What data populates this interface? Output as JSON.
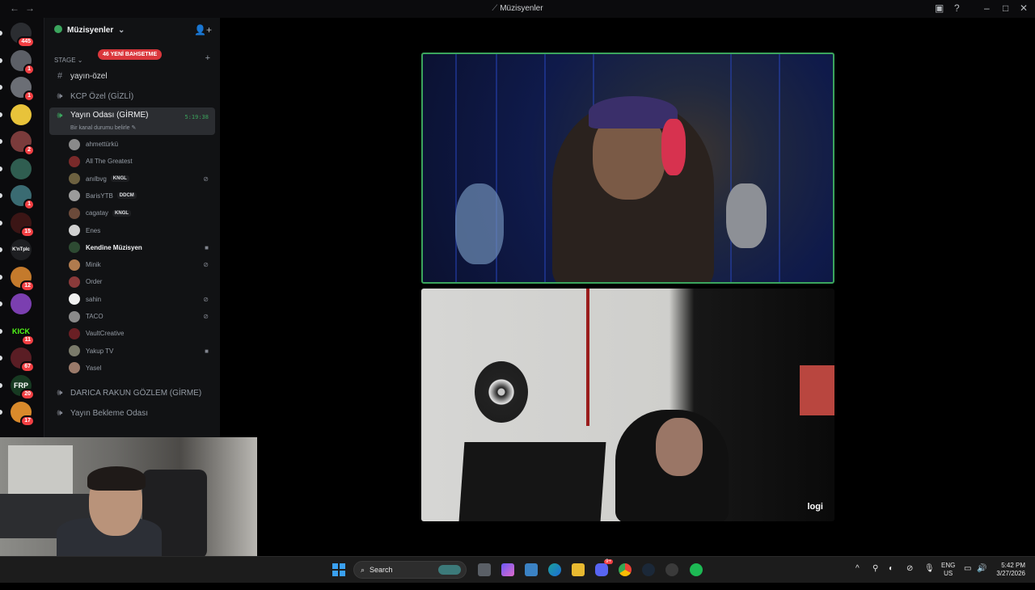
{
  "window": {
    "title": "Müzisyenler"
  },
  "server": {
    "name": "Müzisyenler"
  },
  "rail": {
    "servers": [
      {
        "abbr": "",
        "badge": "445",
        "color": "#2b2d31",
        "icon": "discord-home-icon"
      },
      {
        "abbr": "",
        "badge": "1",
        "color": "#5c5f66",
        "icon": "user-dm-avatar"
      },
      {
        "abbr": "",
        "badge": "1",
        "color": "#6b6e75",
        "icon": "user-dm-avatar"
      },
      {
        "abbr": "",
        "badge": "",
        "color": "#e8c33a",
        "icon": "server-icon"
      },
      {
        "abbr": "",
        "badge": "2",
        "color": "#7a3b3b",
        "icon": "server-icon"
      },
      {
        "abbr": "",
        "badge": "",
        "color": "#2f5d50",
        "icon": "server-icon"
      },
      {
        "abbr": "",
        "badge": "1",
        "color": "#3a6b72",
        "icon": "server-icon"
      },
      {
        "abbr": "",
        "badge": "15",
        "color": "#3b1515",
        "icon": "server-icon"
      },
      {
        "abbr": "K'nTplc",
        "badge": "",
        "color": "#1e1f22",
        "icon": "server-icon"
      },
      {
        "abbr": "",
        "badge": "12",
        "color": "#c47a2c",
        "icon": "server-icon"
      },
      {
        "abbr": "",
        "badge": "",
        "color": "#7b3fb0",
        "icon": "server-icon"
      },
      {
        "abbr": "KICK",
        "badge": "11",
        "color": "#0b0b0d",
        "icon": "kick-icon"
      },
      {
        "abbr": "",
        "badge": "67",
        "color": "#5a1d24",
        "icon": "server-icon"
      },
      {
        "abbr": "FRP",
        "badge": "20",
        "color": "#173a22",
        "icon": "server-icon"
      },
      {
        "abbr": "",
        "badge": "17",
        "color": "#d98a2b",
        "icon": "server-icon"
      }
    ]
  },
  "sidebar": {
    "category": "STAGE",
    "mention_pill": "46 YENİ BAHSETME",
    "channels": {
      "text1": "yayın-özel",
      "voice1": "KCP Özel (GİZLİ)",
      "voice2": "Yayın Odası (GİRME)",
      "voice2_timer": "5:19:38",
      "voice2_status": "Bir kanal durumu belirle",
      "voice3": "DARICA RAKUN GÖZLEM (GİRME)",
      "voice4": "Yayın Bekleme Odası"
    },
    "voice_users": [
      {
        "name": "ahmettürkü",
        "tag": "",
        "status_icon": "",
        "color": "#8a8a8a"
      },
      {
        "name": "All The Greatest",
        "tag": "",
        "status_icon": "",
        "color": "#7a2a2a"
      },
      {
        "name": "anılbvg",
        "tag": "KNGL",
        "status_icon": "muted-icon",
        "color": "#6d6140"
      },
      {
        "name": "BarisYTB",
        "tag": "DDCM",
        "status_icon": "",
        "color": "#9b9b9b"
      },
      {
        "name": "cagatay",
        "tag": "KNGL",
        "status_icon": "",
        "color": "#6b4a3a"
      },
      {
        "name": "Enes",
        "tag": "",
        "status_icon": "",
        "color": "#d0d0d0"
      },
      {
        "name": "Kendine Müzisyen",
        "tag": "",
        "status_icon": "camera-icon",
        "color": "#2d4a32"
      },
      {
        "name": "Minik",
        "tag": "",
        "status_icon": "muted-icon",
        "color": "#b07b4e"
      },
      {
        "name": "Order",
        "tag": "",
        "status_icon": "",
        "color": "#8a3a3a"
      },
      {
        "name": "sahin",
        "tag": "",
        "status_icon": "muted-icon",
        "color": "#f0f0f0"
      },
      {
        "name": "TACO",
        "tag": "",
        "status_icon": "muted-icon",
        "color": "#8a8a8a"
      },
      {
        "name": "VaultCreative",
        "tag": "",
        "status_icon": "",
        "color": "#6a1f24"
      },
      {
        "name": "Yakup TV",
        "tag": "",
        "status_icon": "camera-icon",
        "color": "#7a7a6a"
      },
      {
        "name": "Yasel",
        "tag": "",
        "status_icon": "",
        "color": "#9a7a6a"
      }
    ]
  },
  "video": {
    "watermark": "logi"
  },
  "taskbar": {
    "search_label": "Search",
    "discord_badge": "9+",
    "lang_top": "ENG",
    "lang_bottom": "US",
    "time": "5:42 PM",
    "date": "3/27/2026"
  },
  "colors": {
    "speaking": "#3ba55d",
    "badge": "#f23f43",
    "mention": "#da373c"
  }
}
